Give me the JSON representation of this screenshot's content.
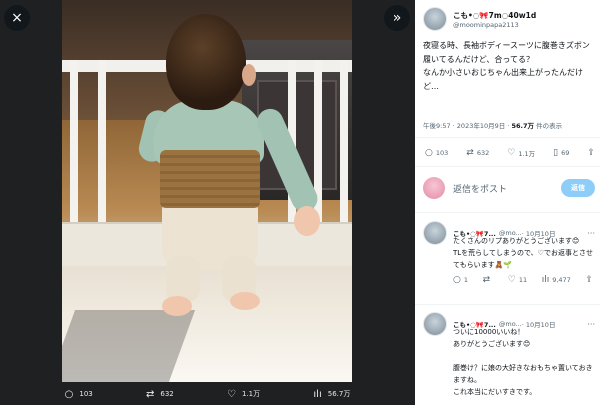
{
  "viewer": {
    "close_icon": "×",
    "next_icon": "»",
    "actions": [
      {
        "icon": "○",
        "name": "reply",
        "count": "103"
      },
      {
        "icon": "⇄",
        "name": "repost",
        "count": "632"
      },
      {
        "icon": "♡",
        "name": "like",
        "count": "1.1万"
      },
      {
        "icon": "ılı",
        "name": "views",
        "count": "56.7万"
      }
    ]
  },
  "tweet": {
    "display_name": "こも•◌🎀7m◌40w1d",
    "handle": "@moominpapa2113",
    "text": "夜寝る時、長袖ボディースーツに腹巻きズボン履いてるんだけど、合ってる？\nなんか小さいおじちゃん出来上がったんだけど…",
    "time": "午後9:57 · 2023年10月9日 · ",
    "views_count": "56.7万",
    "views_label": " 件の表示",
    "actions": {
      "reply": "103",
      "repost": "632",
      "like": "1.1万",
      "bookmark": "69"
    }
  },
  "reply_box": {
    "placeholder": "返信をポスト",
    "button": "返信"
  },
  "replies": [
    {
      "name": "こも•◌🎀7...",
      "handle": "@mo...",
      "date": "· 10月10日",
      "text": "たくさんのリプありがとうございます😊\nTLを荒らしてしまうので、♡でお返事とさせてもらいます🧸🌱",
      "reply_count": "1",
      "repost_count": "",
      "like_count": "11",
      "views_count": "9,477"
    },
    {
      "name": "こも•◌🎀7...",
      "handle": "@mo...",
      "date": "· 10月10日",
      "text": "ついに10000いいね！\nありがとうございます😊\n\n腹巻け？に娘の大好きなおもちゃ置いておきますね。\nこれ本当にだいすきです。"
    }
  ]
}
